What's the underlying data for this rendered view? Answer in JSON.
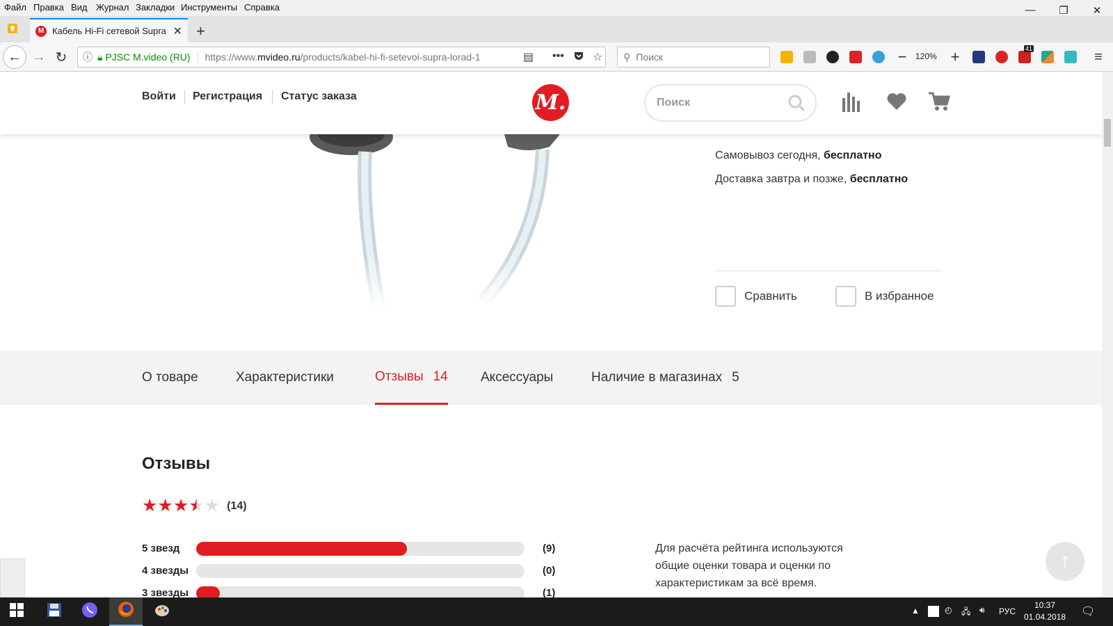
{
  "menubar": {
    "items": [
      "Файл",
      "Правка",
      "Вид",
      "Журнал",
      "Закладки",
      "Инструменты",
      "Справка"
    ]
  },
  "window": {
    "minimize": "—",
    "restore": "❐",
    "close": "✕"
  },
  "tabstrip": {
    "tab_title": "Кабель Hi-Fi сетевой Supra Lo",
    "favicon_letter": "М",
    "new_tab": "+"
  },
  "navbar": {
    "site_identity": "PJSC M.video (RU)",
    "url_prefix": "https://www.",
    "url_domain": "mvideo.ru",
    "url_path": "/products/kabel-hi-fi-setevoi-supra-lorad-1",
    "search_placeholder": "Поиск",
    "zoom": "120%",
    "badge_count": "41"
  },
  "site_header": {
    "login": "Войти",
    "register": "Регистрация",
    "order_status": "Статус заказа",
    "logo_text": "М.",
    "search_placeholder": "Поиск"
  },
  "product": {
    "pickup_text": "Самовывоз сегодня, ",
    "pickup_bold": "бесплатно",
    "delivery_text": "Доставка завтра и позже, ",
    "delivery_bold": "бесплатно",
    "compare": "Сравнить",
    "favorite": "В избранное"
  },
  "tabs": [
    {
      "label": "О товаре",
      "count": ""
    },
    {
      "label": "Характеристики",
      "count": ""
    },
    {
      "label": "Отзывы",
      "count": "14"
    },
    {
      "label": "Аксессуары",
      "count": ""
    },
    {
      "label": "Наличие в магазинах",
      "count": "5"
    }
  ],
  "active_tab": "Отзывы",
  "reviews": {
    "title": "Отзывы",
    "rating": 3.5,
    "total": "(14)",
    "rows": [
      {
        "label": "5 звезд",
        "count": "(9)",
        "share": 0.643
      },
      {
        "label": "4 звезды",
        "count": "(0)",
        "share": 0
      },
      {
        "label": "3 звезды",
        "count": "(1)",
        "share": 0.071
      }
    ],
    "note": "Для расчёта рейтинга используются общие оценки товара и оценки по характеристикам за всё время."
  },
  "taskbar": {
    "lang": "РУС",
    "time": "10:37",
    "date": "01.04.2018"
  },
  "colors": {
    "brand": "#e21c23",
    "firefox_accent": "#0a84ff"
  }
}
